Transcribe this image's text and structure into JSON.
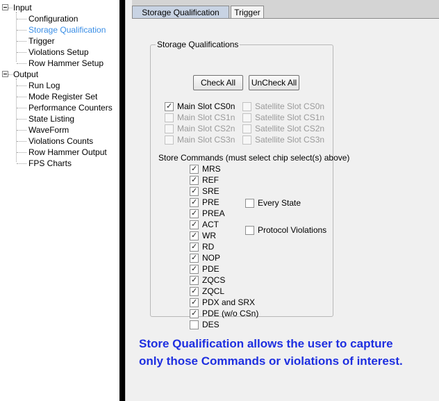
{
  "tree": {
    "input": {
      "label": "Input",
      "children": [
        "Configuration",
        "Storage Qualification",
        "Trigger",
        "Violations Setup",
        "Row Hammer Setup"
      ]
    },
    "output": {
      "label": "Output",
      "children": [
        "Run Log",
        "Mode Register Set",
        "Performance Counters",
        "State Listing",
        "WaveForm",
        "Violations Counts",
        "Row Hammer Output",
        "FPS Charts"
      ]
    },
    "selected": "Storage Qualification"
  },
  "tabs": [
    "Storage Qualification",
    "Trigger"
  ],
  "active_tab": "Storage Qualification",
  "group": {
    "title": "Storage Qualifications",
    "check_all": "Check All",
    "uncheck_all": "UnCheck All",
    "main_slots": [
      {
        "label": "Main Slot CS0n",
        "checked": true,
        "enabled": true
      },
      {
        "label": "Main Slot CS1n",
        "checked": false,
        "enabled": false
      },
      {
        "label": "Main Slot CS2n",
        "checked": false,
        "enabled": false
      },
      {
        "label": "Main Slot CS3n",
        "checked": false,
        "enabled": false
      }
    ],
    "satellite_slots": [
      {
        "label": "Satellite Slot CS0n",
        "checked": false,
        "enabled": false
      },
      {
        "label": "Satellite Slot CS1n",
        "checked": false,
        "enabled": false
      },
      {
        "label": "Satellite Slot CS2n",
        "checked": false,
        "enabled": false
      },
      {
        "label": "Satellite Slot CS3n",
        "checked": false,
        "enabled": false
      }
    ],
    "store_label": "Store Commands (must select chip select(s) above)",
    "commands": [
      {
        "label": "MRS",
        "checked": true
      },
      {
        "label": "REF",
        "checked": true
      },
      {
        "label": "SRE",
        "checked": true
      },
      {
        "label": "PRE",
        "checked": true
      },
      {
        "label": "PREA",
        "checked": true
      },
      {
        "label": "ACT",
        "checked": true
      },
      {
        "label": "WR",
        "checked": true
      },
      {
        "label": "RD",
        "checked": true
      },
      {
        "label": "NOP",
        "checked": true
      },
      {
        "label": "PDE",
        "checked": true
      },
      {
        "label": "ZQCS",
        "checked": true
      },
      {
        "label": "ZQCL",
        "checked": true
      },
      {
        "label": "PDX and SRX",
        "checked": true
      },
      {
        "label": "PDE (w/o CSn)",
        "checked": true
      },
      {
        "label": "DES",
        "checked": false
      }
    ],
    "every_state": {
      "label": "Every State",
      "checked": false
    },
    "protocol_violations": {
      "label": "Protocol Violations",
      "checked": false
    }
  },
  "note": {
    "line1": "Store Qualification allows the user to capture",
    "line2": "only those Commands or violations of interest."
  },
  "colors": {
    "selected_item": "#3a8ee6",
    "note_text": "#1e2fe0",
    "active_tab": "#c8d3e3"
  }
}
